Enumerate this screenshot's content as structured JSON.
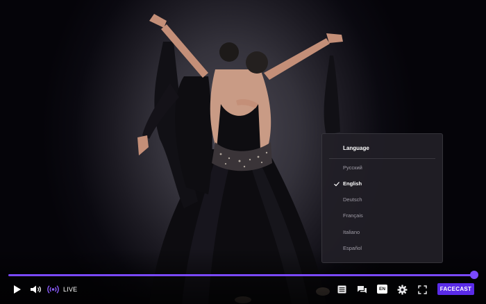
{
  "language_menu": {
    "title": "Language",
    "items": [
      {
        "label": "Русский",
        "selected": false
      },
      {
        "label": "English",
        "selected": true
      },
      {
        "label": "Deutsch",
        "selected": false
      },
      {
        "label": "Français",
        "selected": false
      },
      {
        "label": "Italiano",
        "selected": false
      },
      {
        "label": "Español",
        "selected": false
      }
    ]
  },
  "controls": {
    "live_label": "LIVE",
    "language_badge": "EN",
    "brand_label": "FACECAST",
    "progress_fraction": 1.0,
    "icons": [
      "play-icon",
      "volume-icon",
      "live-broadcast-icon",
      "playlist-icon",
      "chat-icon",
      "settings-gear-icon",
      "fullscreen-icon"
    ]
  },
  "colors": {
    "accent": "#7a49ff",
    "brand_button": "#5a2be8",
    "menu_background": "#211f26"
  }
}
